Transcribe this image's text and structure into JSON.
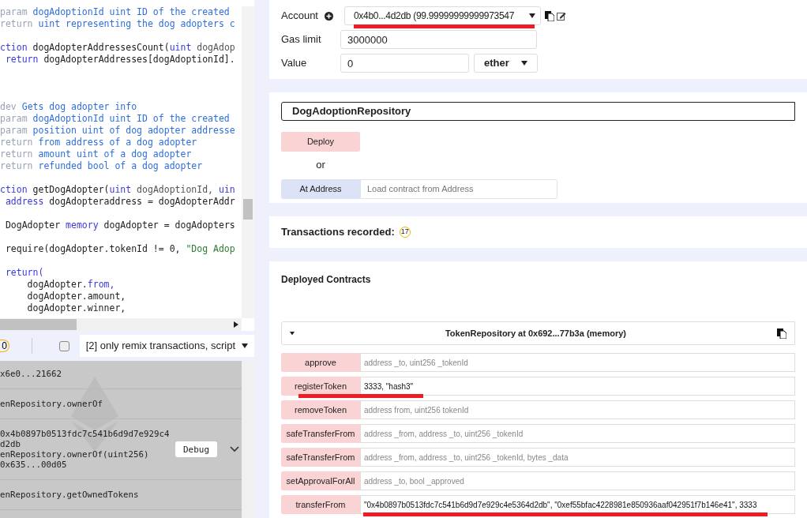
{
  "editor": {
    "lines": [
      {
        "kind": "code",
        "segments": [
          {
            "t": "param ",
            "color": "#9aa3b5"
          },
          {
            "t": "dogAdoptionId uint ID of the created",
            "color": "#2f6fdc"
          }
        ]
      },
      {
        "kind": "code",
        "segments": [
          {
            "t": "return ",
            "color": "#9aa3b5"
          },
          {
            "t": "uint representing the dog adopters c",
            "color": "#2f6fdc"
          }
        ]
      },
      {
        "kind": "blank"
      },
      {
        "kind": "code",
        "segments": [
          {
            "t": "ction ",
            "color": "#3a3ad8"
          },
          {
            "t": "dogAdopterAddressesCount(",
            "color": "#222222"
          },
          {
            "t": "uint ",
            "color": "#3a3ad8"
          },
          {
            "t": "dogAdop",
            "color": "#555555"
          }
        ]
      },
      {
        "kind": "code",
        "segments": [
          {
            "t": " return ",
            "color": "#3a3ad8"
          },
          {
            "t": "dogAdopterAddresses[dogAdoptionId].",
            "color": "#222222"
          }
        ]
      },
      {
        "kind": "blank"
      },
      {
        "kind": "blank"
      },
      {
        "kind": "blank"
      },
      {
        "kind": "code",
        "segments": [
          {
            "t": "dev ",
            "color": "#9aa3b5"
          },
          {
            "t": "Gets dog adopter info",
            "color": "#2f6fdc"
          }
        ]
      },
      {
        "kind": "code",
        "segments": [
          {
            "t": "param ",
            "color": "#9aa3b5"
          },
          {
            "t": "dogAdoptionId uint ID of the created",
            "color": "#2f6fdc"
          }
        ]
      },
      {
        "kind": "code",
        "segments": [
          {
            "t": "param ",
            "color": "#9aa3b5"
          },
          {
            "t": "position uint of dog adopter addresse",
            "color": "#2f6fdc"
          }
        ]
      },
      {
        "kind": "code",
        "segments": [
          {
            "t": "return ",
            "color": "#9aa3b5"
          },
          {
            "t": "from address of a dog adopter",
            "color": "#2f6fdc"
          }
        ]
      },
      {
        "kind": "code",
        "segments": [
          {
            "t": "return ",
            "color": "#9aa3b5"
          },
          {
            "t": "amount uint of a dog adopter",
            "color": "#2f6fdc"
          }
        ]
      },
      {
        "kind": "code",
        "segments": [
          {
            "t": "return ",
            "color": "#9aa3b5"
          },
          {
            "t": "refunded bool of a dog adopter",
            "color": "#2f6fdc"
          }
        ]
      },
      {
        "kind": "blank"
      },
      {
        "kind": "code",
        "segments": [
          {
            "t": "ction ",
            "color": "#3a3ad8"
          },
          {
            "t": "getDogAdopter(",
            "color": "#222222"
          },
          {
            "t": "uint ",
            "color": "#3a3ad8"
          },
          {
            "t": "dogAdoptionId, ",
            "color": "#555555"
          },
          {
            "t": "uin",
            "color": "#3a3ad8"
          }
        ]
      },
      {
        "kind": "code",
        "segments": [
          {
            "t": " address ",
            "color": "#3a3ad8"
          },
          {
            "t": "dogAdopteraddress = dogAdopterAddr",
            "color": "#222222"
          }
        ]
      },
      {
        "kind": "blank"
      },
      {
        "kind": "code",
        "segments": [
          {
            "t": " DogAdopter ",
            "color": "#222222"
          },
          {
            "t": "memory ",
            "color": "#3a3ad8"
          },
          {
            "t": "dogAdopter = dogAdopters",
            "color": "#222222"
          }
        ]
      },
      {
        "kind": "blank"
      },
      {
        "kind": "code",
        "segments": [
          {
            "t": " require(dogAdopter.tokenId != 0, ",
            "color": "#222222"
          },
          {
            "t": "\"Dog Adop",
            "color": "#2e7d32"
          }
        ]
      },
      {
        "kind": "blank"
      },
      {
        "kind": "code",
        "segments": [
          {
            "t": " return(",
            "color": "#3a3ad8"
          }
        ]
      },
      {
        "kind": "code",
        "segments": [
          {
            "t": "     dogAdopter.",
            "color": "#222222"
          },
          {
            "t": "from,",
            "color": "#3a3ad8"
          }
        ]
      },
      {
        "kind": "code",
        "segments": [
          {
            "t": "     dogAdopter.amount,",
            "color": "#222222"
          }
        ]
      },
      {
        "kind": "code",
        "segments": [
          {
            "t": "     dogAdopter.winner,",
            "color": "#222222"
          }
        ]
      }
    ]
  },
  "terminal": {
    "badge": "0",
    "listen_checked": false,
    "filter": "[2] only remix transactions, script",
    "logs": [
      {
        "lines": [
          "x6e0...21662"
        ]
      },
      {
        "lines": [
          "enRepository.ownerOf"
        ]
      },
      {
        "lines": [
          "0x4b0897b0513fdc7c541b6d9d7e929c4",
          "d2db",
          "enRepository.ownerOf(uint256)",
          "0x635...00d05"
        ],
        "debug": "Debug",
        "expanded": false
      },
      {
        "lines": [
          "enRepository.getOwnedTokens"
        ]
      }
    ]
  },
  "environment": {
    "account_label": "Account",
    "account": "0x4b0...4d2db (99.99999999999973547",
    "account_underlined": true,
    "gas_label": "Gas limit",
    "gas": "3000000",
    "value_label": "Value",
    "value": "0",
    "unit": "ether"
  },
  "deploy": {
    "contract": "DogAdoptionRepository",
    "deploy": "Deploy",
    "or": "or",
    "at_address": "At Address",
    "address_placeholder": "Load contract from Address"
  },
  "transactions": {
    "label": "Transactions recorded:",
    "count": "17"
  },
  "deployed": {
    "title": "Deployed Contracts",
    "instance": "TokenRepository at 0x692...77b3a (memory)",
    "expanded": true,
    "functions": [
      {
        "name": "approve",
        "placeholder": "address _to, uint256 _tokenId",
        "underlined": false
      },
      {
        "name": "registerToken",
        "value": "3333, \"hash3\"",
        "underlined": true
      },
      {
        "name": "removeToken",
        "placeholder": "address from, uint256 tokenId",
        "underlined": false
      },
      {
        "name": "safeTransferFrom",
        "placeholder": "address _from, address _to, uint256 _tokenId",
        "underlined": false
      },
      {
        "name": "safeTransferFrom",
        "placeholder": "address _from, address _to, uint256 _tokenId, bytes _data",
        "underlined": false
      },
      {
        "name": "setApprovalForAll",
        "placeholder": "address _to, bool _approved",
        "underlined": false
      },
      {
        "name": "transferFrom",
        "value": "\"0x4b0897b0513fdc7c541b6d9d7e929c4e5364d2db\", \"0xef55bfac4228981e850936aaf042951f7b146e41\", 3333",
        "underlined": true
      }
    ]
  }
}
